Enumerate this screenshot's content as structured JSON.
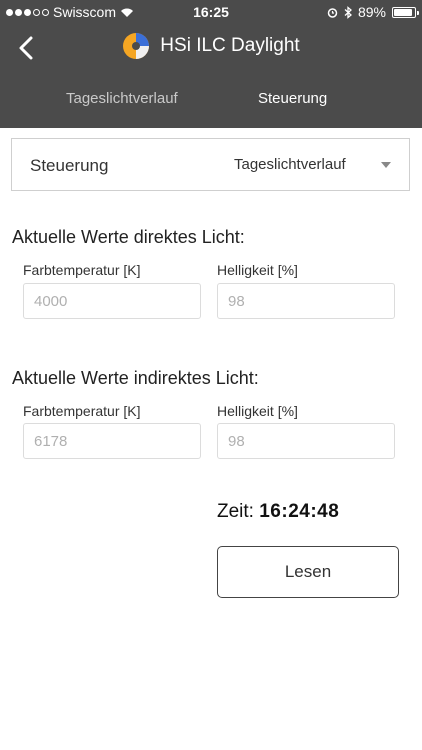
{
  "status_bar": {
    "carrier": "Swisscom",
    "time": "16:25",
    "battery": "89%",
    "battery_level": 0.89
  },
  "nav": {
    "title": "HSi ILC Daylight",
    "tabs": [
      {
        "label": "Tageslichtverlauf",
        "active": false
      },
      {
        "label": "Steuerung",
        "active": true
      }
    ]
  },
  "select": {
    "label": "Steuerung",
    "value": "Tageslichtverlauf"
  },
  "direct": {
    "title": "Aktuelle Werte direktes Licht:",
    "color_temp_label": "Farbtemperatur [K]",
    "color_temp_value": "4000",
    "brightness_label": "Helligkeit [%]",
    "brightness_value": "98"
  },
  "indirect": {
    "title": "Aktuelle Werte indirektes Licht:",
    "color_temp_label": "Farbtemperatur [K]",
    "color_temp_value": "6178",
    "brightness_label": "Helligkeit [%]",
    "brightness_value": "98"
  },
  "time_readout": {
    "label": "Zeit:",
    "value": "16:24:48"
  },
  "read_button": {
    "label": "Lesen"
  },
  "colors": {
    "header_bg": "#4b4b4b",
    "inactive_tab": "#c9c9c9",
    "logo_orange": "#f5a623",
    "logo_blue": "#3b6fd8"
  }
}
